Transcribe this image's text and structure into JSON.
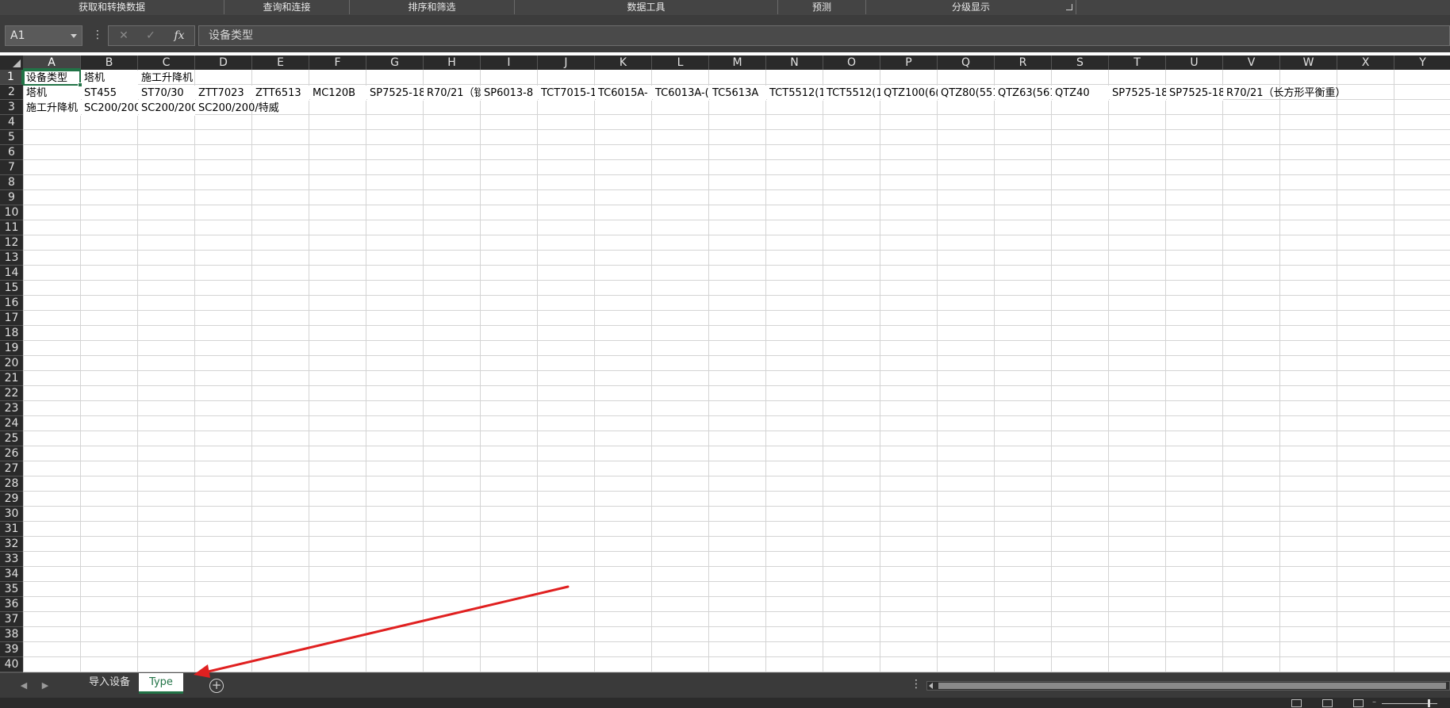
{
  "ribbon": {
    "groups": [
      "获取和转换数据",
      "查询和连接",
      "排序和筛选",
      "数据工具",
      "预测",
      "分级显示"
    ]
  },
  "formula_bar": {
    "name_box": "A1",
    "cancel_icon": "✕",
    "enter_icon": "✓",
    "fx_label": "fx",
    "content": "设备类型"
  },
  "columns": [
    "A",
    "B",
    "C",
    "D",
    "E",
    "F",
    "G",
    "H",
    "I",
    "J",
    "K",
    "L",
    "M",
    "N",
    "O",
    "P",
    "Q",
    "R",
    "S",
    "T",
    "U",
    "V",
    "W",
    "X",
    "Y"
  ],
  "rows": [
    "1",
    "2",
    "3",
    "4",
    "5",
    "6",
    "7",
    "8",
    "9",
    "10",
    "11",
    "12",
    "13",
    "14",
    "15",
    "16",
    "17",
    "18",
    "19",
    "20",
    "21",
    "22",
    "23",
    "24",
    "25",
    "26",
    "27",
    "28",
    "29",
    "30",
    "31",
    "32",
    "33",
    "34",
    "35",
    "36",
    "37",
    "38",
    "39",
    "40"
  ],
  "cells": {
    "r1": [
      "设备类型",
      "塔机",
      "施工升降机"
    ],
    "r2": [
      "塔机",
      "ST455",
      "ST70/30",
      "ZTT7023",
      "ZTT6513",
      "MC120B",
      "SP7525-18",
      "R70/21（锁",
      "SP6013-8",
      "TCT7015-1",
      "TC6015A-",
      "TC6013A-(",
      "TC5613A",
      "TCT5512(1",
      "TCT5512(1",
      "QTZ100(6(",
      "QTZ80(551",
      "QTZ63(561",
      "QTZ40",
      "SP7525-18",
      "SP7525-18",
      "R70/21（长方形平衡重）"
    ],
    "r3": [
      "施工升降机",
      "SC200/200",
      "SC200/200",
      "SC200/200/特威"
    ]
  },
  "sheet_tabs": [
    "导入设备",
    "Type"
  ],
  "active_sheet": "Type",
  "colors": {
    "accent": "#217346",
    "annotation_arrow": "#e02020"
  }
}
